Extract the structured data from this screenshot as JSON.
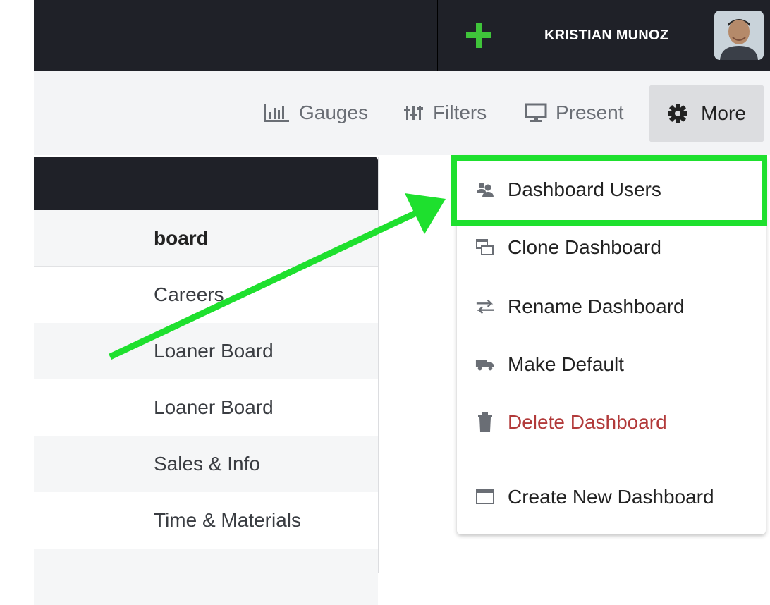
{
  "header": {
    "user_name": "KRISTIAN MUNOZ"
  },
  "toolbar": {
    "gauges_label": "Gauges",
    "filters_label": "Filters",
    "present_label": "Present",
    "more_label": "More"
  },
  "table": {
    "column_header": "board",
    "rows": [
      {
        "label": "Careers"
      },
      {
        "label": "Loaner Board"
      },
      {
        "label": "Loaner Board"
      },
      {
        "label": "Sales & Info"
      },
      {
        "label": "Time & Materials"
      }
    ]
  },
  "menu": {
    "items": [
      {
        "label": "Dashboard Users",
        "icon": "users-icon"
      },
      {
        "label": "Clone Dashboard",
        "icon": "clone-icon"
      },
      {
        "label": "Rename Dashboard",
        "icon": "exchange-icon"
      },
      {
        "label": "Make Default",
        "icon": "truck-icon"
      },
      {
        "label": "Delete Dashboard",
        "icon": "trash-icon"
      },
      {
        "label": "Create New Dashboard",
        "icon": "window-icon"
      }
    ]
  },
  "colors": {
    "topbar": "#1f2128",
    "accent_green": "#1ee02e",
    "danger": "#b23a3a"
  }
}
